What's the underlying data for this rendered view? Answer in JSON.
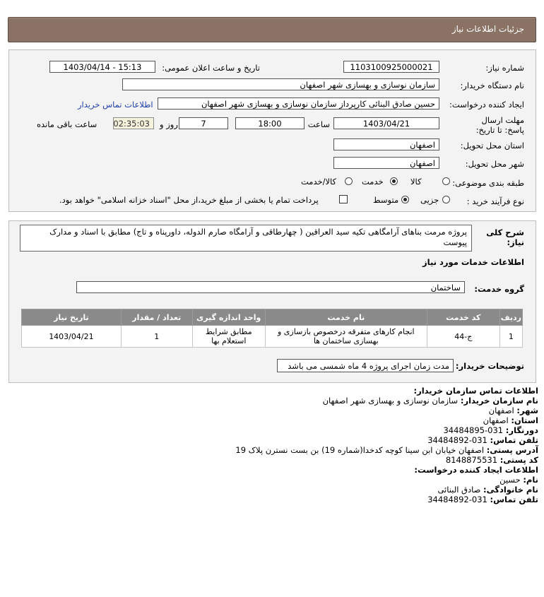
{
  "header": {
    "title": "جزئیات اطلاعات نیاز"
  },
  "form": {
    "need_number_label": "شماره نیاز:",
    "need_number": "1103100925000021",
    "announce_label": "تاریخ و ساعت اعلان عمومی:",
    "announce_value": "1403/04/14 - 15:13",
    "buyer_org_label": "نام دستگاه خریدار:",
    "buyer_org": "سازمان نوسازی و بهسازی شهر اصفهان",
    "requester_label": "ایجاد کننده درخواست:",
    "requester": "حسین صادق البنائی کارپرداز سازمان نوسازی و بهسازی شهر اصفهان",
    "contact_link": "اطلاعات تماس خریدار",
    "deadline_label": "مهلت ارسال پاسخ: تا تاریخ:",
    "deadline_date": "1403/04/21",
    "time_label": "ساعت",
    "deadline_time": "18:00",
    "days_value": "7",
    "days_label": "روز و",
    "remaining_time": "02:35:03",
    "remaining_label": "ساعت باقی مانده",
    "delivery_province_label": "استان محل تحویل:",
    "delivery_province": "اصفهان",
    "delivery_city_label": "شهر محل تحویل:",
    "delivery_city": "اصفهان",
    "category_label": "طبقه بندی موضوعی:",
    "category_options": [
      "کالا",
      "خدمت",
      "کالا/خدمت"
    ],
    "category_selected": "خدمت",
    "process_label": "نوع فرآیند خرید :",
    "process_options": [
      "جزیی",
      "متوسط"
    ],
    "process_selected": "متوسط",
    "treasury_note": "پرداخت تمام یا بخشی از مبلغ خرید،از محل \"اسناد خزانه اسلامی\" خواهد بود."
  },
  "details": {
    "description_label": "شرح کلی نیاز:",
    "description": "پروژه مرمت بناهای آرامگاهی تکیه سید العراقین ( چهارطاقی و آرامگاه صارم الدوله، داورپناه و تاج) مطابق با اسناد و مدارک پیوست",
    "services_title": "اطلاعات خدمات مورد نیاز",
    "service_group_label": "گروه خدمت:",
    "service_group": "ساختمان",
    "table": {
      "headers": [
        "ردیف",
        "کد خدمت",
        "نام خدمت",
        "واحد اندازه گیری",
        "تعداد / مقدار",
        "تاریخ نیاز"
      ],
      "rows": [
        [
          "1",
          "ج-44",
          "انجام کارهای متفرقه درخصوص بازسازی و بهسازی ساختمان ها",
          "مطابق شرایط استعلام بها",
          "1",
          "1403/04/21"
        ]
      ]
    },
    "buyer_notes_label": "توضیحات خریدار:",
    "buyer_notes": "مدت زمان اجرای پروژه 4 ماه شمسی می باشد"
  },
  "contact": {
    "section_title": "اطلاعات تماس سازمان خریدار:",
    "org_label": "نام سازمان خریدار:",
    "org": "سازمان نوسازی و بهسازی شهر اصفهان",
    "city_label": "شهر:",
    "city": "اصفهان",
    "province_label": "استان:",
    "province": "اصفهان",
    "fax_label": "دورنگار:",
    "fax": "031-34484895",
    "phone_label": "تلفن تماس:",
    "phone": "031-34484892",
    "address_label": "آدرس پستی:",
    "address": "اصفهان خیابان ابن سینا کوچه کدخدا(شماره 19) بن بست نسترن پلاک 19",
    "postal_label": "کد پستی:",
    "postal": "8148875531",
    "creator_title": "اطلاعات ایجاد کننده درخواست:",
    "first_name_label": "نام:",
    "first_name": "حسین",
    "last_name_label": "نام خانوادگی:",
    "last_name": "صادق البنائی",
    "creator_phone_label": "تلفن تماس:",
    "creator_phone": "031-34484892"
  }
}
